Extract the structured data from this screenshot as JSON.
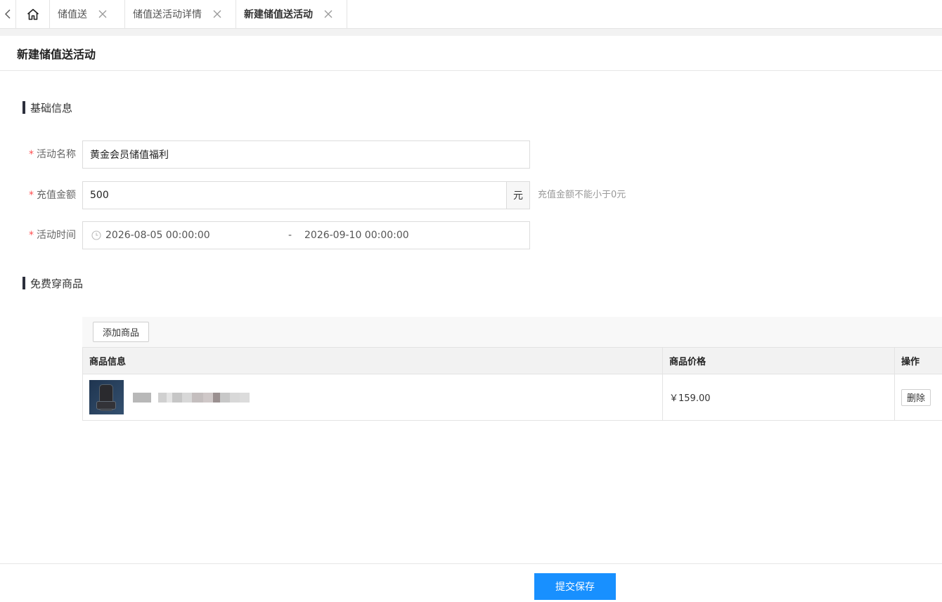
{
  "tabs": [
    {
      "label": "储值送"
    },
    {
      "label": "储值送活动详情"
    },
    {
      "label": "新建储值送活动"
    }
  ],
  "page": {
    "title": "新建储值送活动"
  },
  "sections": {
    "basic": "基础信息",
    "products": "免费穿商品"
  },
  "form": {
    "name": {
      "label": "活动名称",
      "value": "黄金会员储值福利"
    },
    "amount": {
      "label": "充值金额",
      "value": "500",
      "suffix": "元",
      "hint": "充值金额不能小于0元"
    },
    "time": {
      "label": "活动时间",
      "start": "2026-08-05 00:00:00",
      "separator": "-",
      "end": "2026-09-10 00:00:00"
    }
  },
  "products": {
    "add_button": "添加商品",
    "columns": [
      "商品信息",
      "商品价格",
      "操作"
    ],
    "rows": [
      {
        "price": "￥159.00",
        "action": "删除"
      }
    ]
  },
  "footer": {
    "submit": "提交保存"
  },
  "colors": {
    "primary": "#1890ff",
    "required": "#ff4d4f",
    "section_bar": "#2c2f3c"
  }
}
